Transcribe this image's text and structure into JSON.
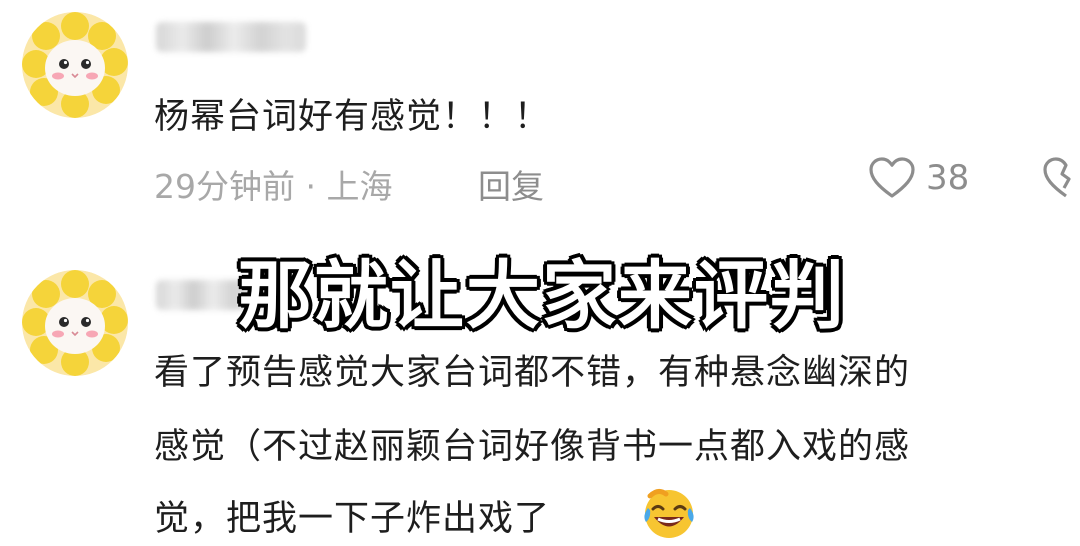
{
  "comments": [
    {
      "text": "杨幂台词好有感觉！！！",
      "meta": "29分钟前 · 上海",
      "reply_label": "回复",
      "like_count": "38"
    },
    {
      "lines": [
        "看了预告感觉大家台词都不错，有种悬念幽深的",
        "感觉（不过赵丽颖台词好像背书一点都入戏的感",
        "觉，把我一下子炸出戏了"
      ],
      "emoji": "laughing-crying-emoji"
    }
  ],
  "overlay_caption": "那就让大家来评判",
  "icons": {
    "like": "heart-outline-icon",
    "dislike": "broken-heart-icon"
  },
  "colors": {
    "text": "#1e1e1e",
    "meta": "#a8a8a8",
    "caption_fill": "#ffffff",
    "caption_stroke": "#000000"
  }
}
